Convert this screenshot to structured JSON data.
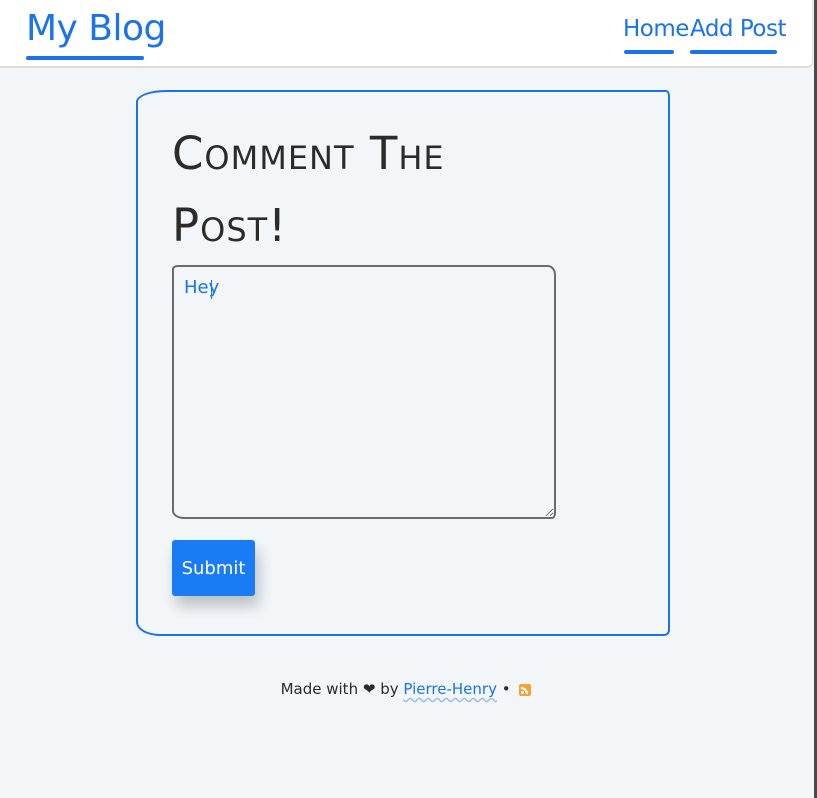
{
  "navbar": {
    "brand": "My Blog",
    "links": [
      {
        "label": "Home"
      },
      {
        "label": "Add Post"
      }
    ]
  },
  "comment_form": {
    "title": "Comment The Post!",
    "textarea_value": "Hey",
    "submit_label": "Submit"
  },
  "footer": {
    "prefix": "Made with",
    "heart": "❤",
    "by": "by",
    "author": "Pierre-Henry",
    "separator": "•",
    "rss_icon": "rss-icon"
  },
  "colors": {
    "accent": "#1a73e8",
    "button": "#1a7cf5",
    "background": "#f2f6f9",
    "rss": "#f2a33a"
  }
}
